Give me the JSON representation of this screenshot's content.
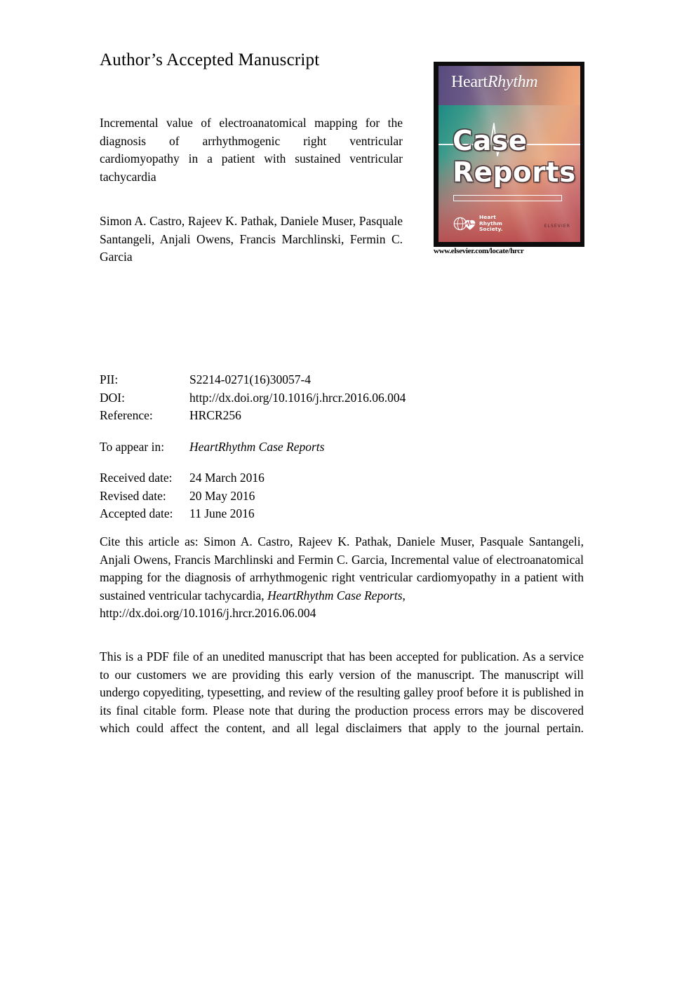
{
  "header": {
    "accepted_manuscript_label": "Author’s Accepted Manuscript"
  },
  "article": {
    "title": "Incremental value of electroanatomical mapping for the diagnosis of arrhythmogenic right ventricular cardiomyopathy in a patient with sustained ventricular tachycardia",
    "authors": "Simon A. Castro, Rajeev K. Pathak, Daniele Muser, Pasquale Santangeli, Anjali Owens, Francis Marchlinski, Fermin C. Garcia"
  },
  "cover": {
    "masthead_regular": "Heart",
    "masthead_italic": "Rhythm",
    "word_case": "Case",
    "word_reports": "Reports",
    "society_line1": "Heart",
    "society_line2": "Rhythm",
    "society_line3": "Society.",
    "publisher_mark": "ELSEVIER",
    "url": "www.elsevier.com/locate/hrcr",
    "colors": {
      "band_top_start": "#574a7e",
      "band_top_end": "#f0aa80",
      "band_body_start": "#1d8a84",
      "band_body_mid": "#e8a77e",
      "band_body_end": "#b7494d",
      "frame": "#0d0d0d",
      "text": "#ffffff"
    }
  },
  "metadata": {
    "rows": [
      {
        "label": "PII:",
        "value": "S2214-0271(16)30057-4"
      },
      {
        "label": "DOI:",
        "value": "http://dx.doi.org/10.1016/j.hrcr.2016.06.004"
      },
      {
        "label": "Reference:",
        "value": "HRCR256"
      }
    ],
    "to_appear_in": {
      "label": "To appear in:",
      "value": "HeartRhythm Case Reports"
    },
    "dates": [
      {
        "label": "Received date:",
        "value": "24 March 2016"
      },
      {
        "label": "Revised date:",
        "value": "20 May 2016"
      },
      {
        "label": "Accepted date:",
        "value": "11 June 2016"
      }
    ]
  },
  "citation": {
    "lead": "Cite this article as: Simon A. Castro, Rajeev K. Pathak, Daniele Muser, Pasquale Santangeli, Anjali Owens, Francis Marchlinski and Fermin C. Garcia, Incremental value of electroanatomical mapping for the diagnosis of arrhythmogenic right ventricular cardiomyopathy in a patient with sustained ventricular tachycardia, ",
    "journal_italic": "HeartRhythm Case Reports",
    "after_journal": ",",
    "doi_line": "http://dx.doi.org/10.1016/j.hrcr.2016.06.004"
  },
  "disclaimer": {
    "text": "This is a PDF file of an unedited manuscript that has been accepted for publication. As a service to our customers we are providing this early version of the manuscript. The manuscript will undergo copyediting, typesetting, and review of the resulting galley proof before it is published in its final citable form. Please note that during the production process errors may be discovered which could affect the content, and all legal disclaimers that apply to the journal pertain."
  }
}
